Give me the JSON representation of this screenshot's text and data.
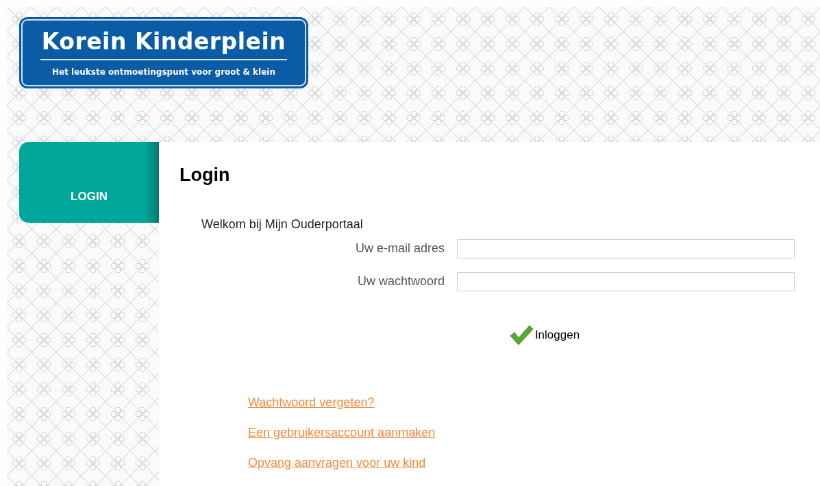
{
  "logo": {
    "title": "Korein Kinderplein",
    "tagline": "Het leukste ontmoetingspunt voor groot & klein"
  },
  "nav": [
    {
      "label": "LOGIN",
      "selected": true
    }
  ],
  "heading": "Login",
  "welcome": "Welkom bij Mijn Ouderportaal",
  "fields": [
    {
      "label": "Uw e-mail adres"
    },
    {
      "label": "Uw wachtwoord"
    }
  ],
  "login_button": "Inloggen",
  "links": [
    "Wachtwoord vergeten?",
    "Een gebruikersaccount aanmaken",
    "Opvang aanvragen voor uw kind"
  ]
}
